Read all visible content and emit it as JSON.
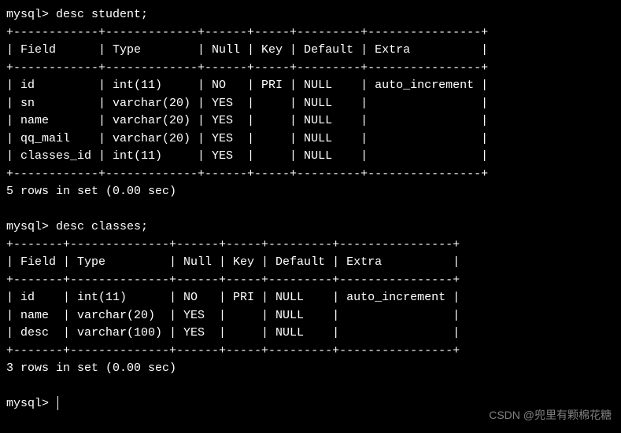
{
  "prompt_text": "mysql>",
  "query1": {
    "command": "desc student;",
    "border_top": "+------------+-------------+------+-----+---------+----------------+",
    "header": "| Field      | Type        | Null | Key | Default | Extra          |",
    "border_mid": "+------------+-------------+------+-----+---------+----------------+",
    "rows": [
      "| id         | int(11)     | NO   | PRI | NULL    | auto_increment |",
      "| sn         | varchar(20) | YES  |     | NULL    |                |",
      "| name       | varchar(20) | YES  |     | NULL    |                |",
      "| qq_mail    | varchar(20) | YES  |     | NULL    |                |",
      "| classes_id | int(11)     | YES  |     | NULL    |                |"
    ],
    "border_bot": "+------------+-------------+------+-----+---------+----------------+",
    "result": "5 rows in set (0.00 sec)"
  },
  "query2": {
    "command": "desc classes;",
    "border_top": "+-------+--------------+------+-----+---------+----------------+",
    "header": "| Field | Type         | Null | Key | Default | Extra          |",
    "border_mid": "+-------+--------------+------+-----+---------+----------------+",
    "rows": [
      "| id    | int(11)      | NO   | PRI | NULL    | auto_increment |",
      "| name  | varchar(20)  | YES  |     | NULL    |                |",
      "| desc  | varchar(100) | YES  |     | NULL    |                |"
    ],
    "border_bot": "+-------+--------------+------+-----+---------+----------------+",
    "result": "3 rows in set (0.00 sec)"
  },
  "watermark": "CSDN @兜里有颗棉花糖"
}
